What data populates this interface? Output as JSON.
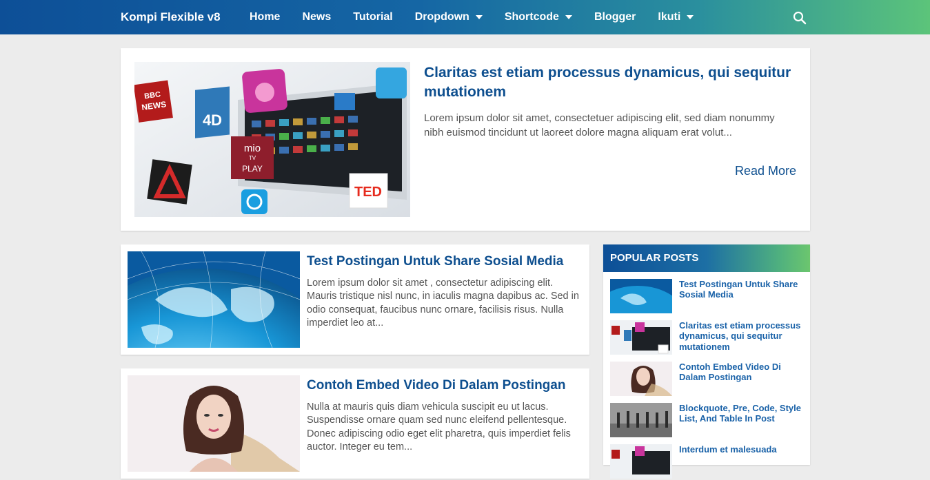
{
  "header": {
    "brand": "Kompi Flexible v8",
    "nav": [
      {
        "label": "Home",
        "dropdown": false
      },
      {
        "label": "News",
        "dropdown": false
      },
      {
        "label": "Tutorial",
        "dropdown": false
      },
      {
        "label": "Dropdown",
        "dropdown": true
      },
      {
        "label": "Shortcode",
        "dropdown": true
      },
      {
        "label": "Blogger",
        "dropdown": false
      },
      {
        "label": "Ikuti",
        "dropdown": true
      }
    ],
    "search_icon": "search-icon"
  },
  "featured": {
    "title": "Claritas est etiam processus dynamicus, qui sequitur mutationem",
    "excerpt": "Lorem ipsum dolor sit amet, consectetuer adipiscing elit, sed diam nonummy nibh euismod tincidunt ut laoreet dolore magna aliquam erat volut...",
    "read_more": "Read More",
    "thumb_labels": {
      "bbc": "BBC",
      "news": "NEWS",
      "fourd": "4D",
      "mio": "mio",
      "tv": "TV",
      "play": "PLAY",
      "ted": "TED"
    }
  },
  "posts": [
    {
      "title": "Test Postingan Untuk Share Sosial Media",
      "excerpt": "Lorem ipsum dolor sit amet , consectetur adipiscing elit. Mauris tristique nisl nunc, in iaculis magna dapibus ac. Sed in odio consequat, faucibus nunc ornare, facilisis risus. Nulla imperdiet leo at..."
    },
    {
      "title": "Contoh Embed Video Di Dalam Postingan",
      "excerpt": "Nulla at mauris quis diam vehicula suscipit eu ut lacus. Suspendisse ornare quam sed nunc eleifend pellentesque. Donec adipiscing odio eget elit pharetra, quis imperdiet felis auctor. Integer eu tem..."
    }
  ],
  "sidebar": {
    "heading": "POPULAR POSTS",
    "items": [
      {
        "title": "Test Postingan Untuk Share Sosial Media"
      },
      {
        "title": "Claritas est etiam processus dynamicus, qui sequitur mutationem"
      },
      {
        "title": "Contoh Embed Video Di Dalam Postingan"
      },
      {
        "title": "Blockquote, Pre, Code, Style List, And Table In Post"
      },
      {
        "title": "Interdum et malesuada"
      }
    ]
  },
  "colors": {
    "accent": "#0e4f8f",
    "link": "#1a62a8",
    "gradient_end": "#6cc66e"
  }
}
